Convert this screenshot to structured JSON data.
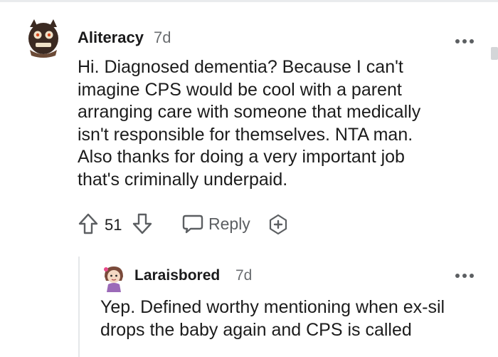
{
  "comment": {
    "author": "Aliteracy",
    "age": "7d",
    "avatar_icon": "creature-avatar-icon",
    "text": "Hi. Diagnosed dementia? Because I can't\nimagine CPS would be cool with a parent\narranging care with someone that medically\nisn't responsible for themselves. NTA man.\nAlso thanks for doing a very important job\nthat's criminally underpaid.",
    "score": "51",
    "reply_label": "Reply"
  },
  "reply": {
    "author": "Laraisbored",
    "age": "7d",
    "avatar_icon": "girl-avatar-icon",
    "text": "Yep. Defined worthy mentioning when ex-sil drops the baby again and CPS is called"
  },
  "colors": {
    "text": "#1c1c1c",
    "muted": "#6a6d70",
    "icon": "#5c5f62",
    "divider": "#e5e7e9"
  }
}
